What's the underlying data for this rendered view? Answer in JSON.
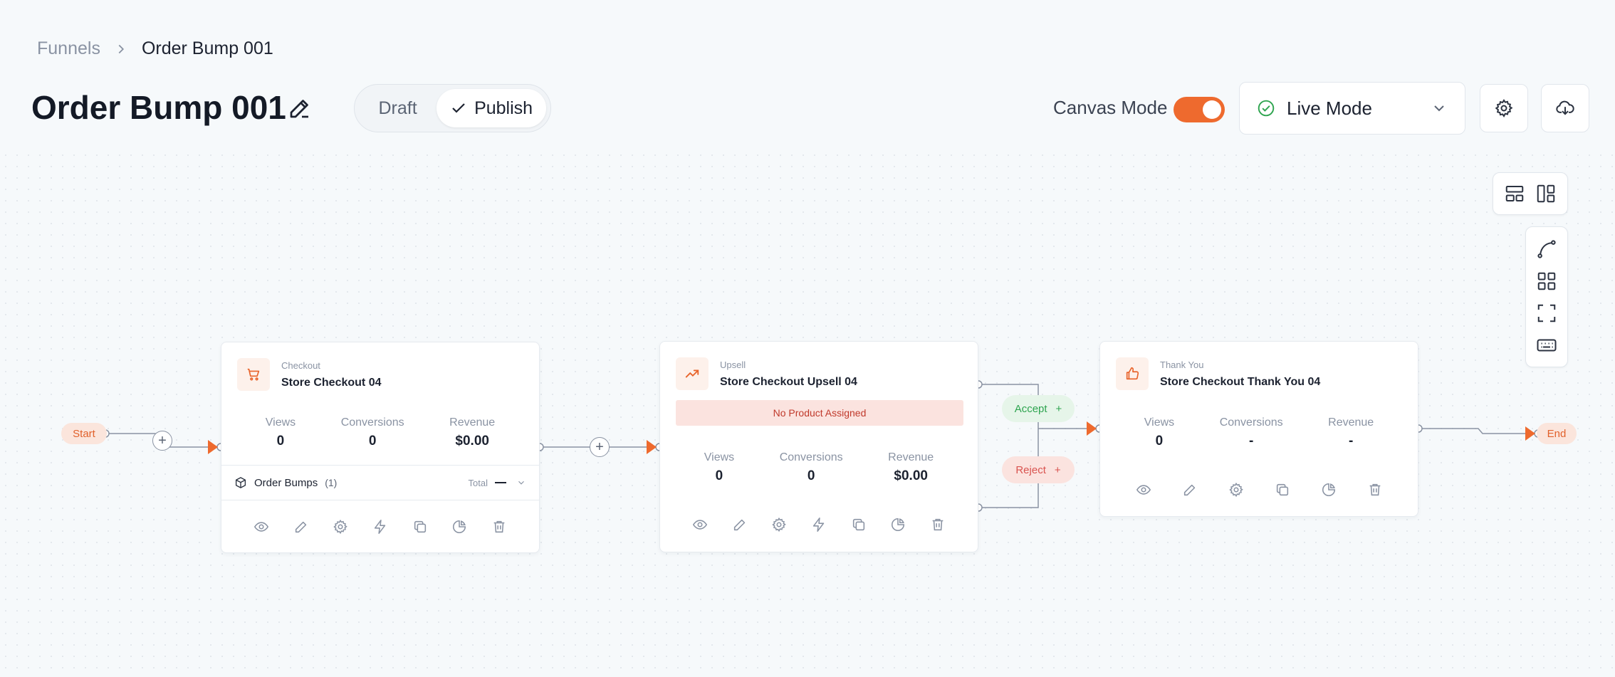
{
  "breadcrumb": {
    "root": "Funnels",
    "current": "Order Bump 001"
  },
  "page_title": "Order Bump 001",
  "status": {
    "draft": "Draft",
    "publish": "Publish",
    "selected": "Publish"
  },
  "canvas_mode": {
    "label": "Canvas Mode",
    "enabled": true
  },
  "mode_select": {
    "value": "Live Mode"
  },
  "flow": {
    "start": "Start",
    "end": "End",
    "accept": "Accept",
    "reject": "Reject",
    "plus": "+",
    "nodes": [
      {
        "type": "Checkout",
        "name": "Store Checkout 04",
        "icon": "cart-icon",
        "stats": [
          {
            "label": "Views",
            "value": "0"
          },
          {
            "label": "Conversions",
            "value": "0"
          },
          {
            "label": "Revenue",
            "value": "$0.00"
          }
        ],
        "order_bumps": {
          "label": "Order Bumps",
          "count": "(1)",
          "total": "Total"
        }
      },
      {
        "type": "Upsell",
        "name": "Store Checkout Upsell 04",
        "icon": "trending-up-icon",
        "warning": "No Product Assigned",
        "stats": [
          {
            "label": "Views",
            "value": "0"
          },
          {
            "label": "Conversions",
            "value": "0"
          },
          {
            "label": "Revenue",
            "value": "$0.00"
          }
        ]
      },
      {
        "type": "Thank You",
        "name": "Store Checkout Thank You 04",
        "icon": "thumbs-up-icon",
        "stats": [
          {
            "label": "Views",
            "value": "0"
          },
          {
            "label": "Conversions",
            "value": "-"
          },
          {
            "label": "Revenue",
            "value": "-"
          }
        ]
      }
    ]
  },
  "colors": {
    "accent": "#ee6a2e",
    "success": "#2ea44f",
    "danger": "#d9534f",
    "background": "#f6f9fb"
  },
  "icons": {
    "node_actions": [
      "eye-icon",
      "pencil-icon",
      "gear-icon",
      "lightning-icon",
      "copy-icon",
      "pie-chart-icon",
      "trash-icon"
    ],
    "thank_you_actions": [
      "eye-icon",
      "pencil-icon",
      "gear-icon",
      "copy-icon",
      "pie-chart-icon",
      "trash-icon"
    ],
    "toolbar": [
      "layout-horizontal-icon",
      "layout-vertical-icon",
      "curve-icon",
      "grid-icon",
      "fullscreen-icon",
      "keyboard-icon"
    ]
  }
}
